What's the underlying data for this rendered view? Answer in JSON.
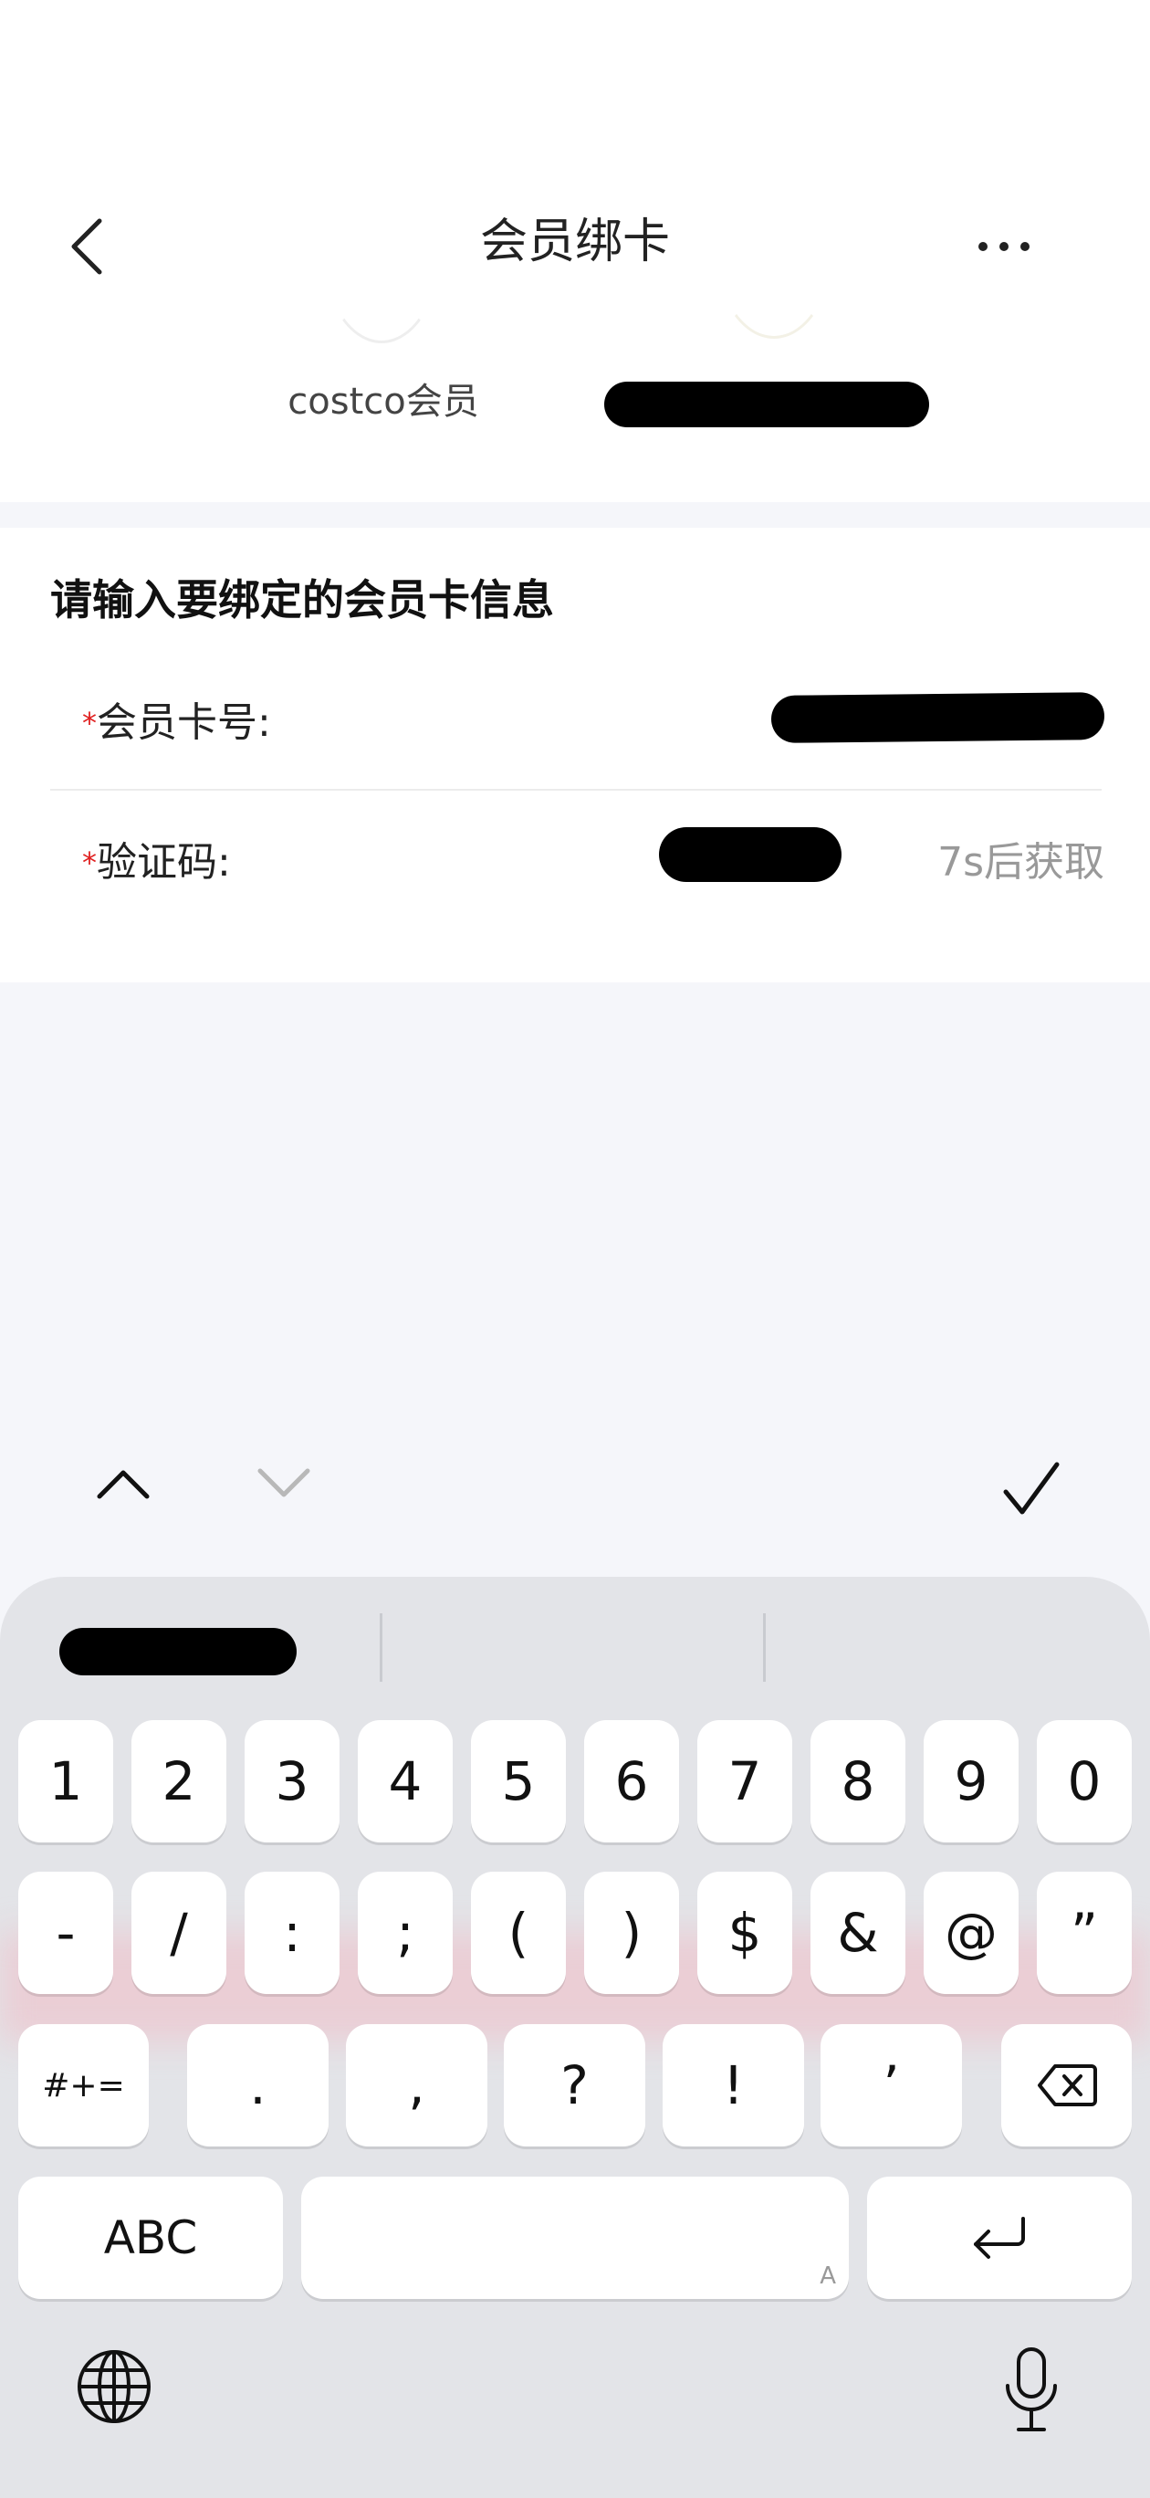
{
  "header": {
    "title": "会员绑卡",
    "member_label": "costco会员"
  },
  "form": {
    "heading": "请输入要绑定的会员卡信息",
    "required_mark": "*",
    "card_label": "会员卡号:",
    "code_label": "验证码:",
    "resend_text": "7s后获取"
  },
  "keyboard": {
    "row1": [
      "1",
      "2",
      "3",
      "4",
      "5",
      "6",
      "7",
      "8",
      "9",
      "0"
    ],
    "row2": [
      "-",
      "/",
      ":",
      ";",
      "(",
      ")",
      "$",
      "&",
      "@",
      "”"
    ],
    "row3": [
      "#+=",
      ".",
      ",",
      "?",
      "!",
      "’"
    ],
    "abc_label": "ABC",
    "space_hint": "A"
  },
  "icons": {
    "back": "chevron-left-icon",
    "more": "more-dots-icon",
    "prev_field": "chevron-up-icon",
    "next_field": "chevron-down-icon",
    "done": "checkmark-icon",
    "backspace": "backspace-icon",
    "enter": "return-icon",
    "globe": "globe-icon",
    "mic": "microphone-icon"
  },
  "colors": {
    "required": "#e02020",
    "resend_text": "#999999",
    "keyboard_bg": "#e3e4e8",
    "page_bg": "#f5f6fa"
  }
}
